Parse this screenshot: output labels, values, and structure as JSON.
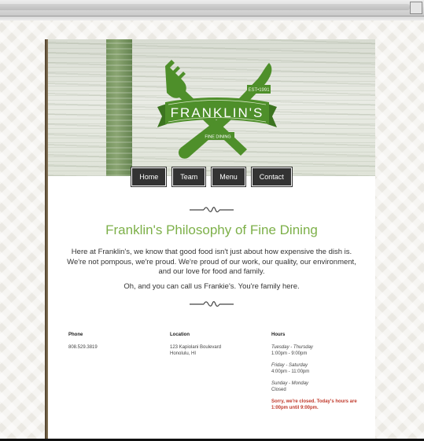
{
  "nav": {
    "items": [
      {
        "label": "Home"
      },
      {
        "label": "Team"
      },
      {
        "label": "Menu"
      },
      {
        "label": "Contact"
      }
    ]
  },
  "logo": {
    "name": "FRANKLIN'S",
    "est": "EST•1991",
    "tagline": "FINE DINING",
    "color": "#4e8f2a"
  },
  "main": {
    "title": "Franklin's Philosophy of Fine Dining",
    "intro": "Here at Franklin's, we know that good food isn't just about how expensive the dish is. We're not pompous, we're proud. We're proud of our work, our quality, our environment, and our love for food and family.",
    "intro2": "Oh, and you can call us Frankie's. You're family here."
  },
  "footer": {
    "phone": {
      "heading": "Phone",
      "value": "808.529.3819"
    },
    "location": {
      "heading": "Location",
      "line1": "123 Kapiolani Boulevard",
      "line2": "Honolulu, HI"
    },
    "hours": {
      "heading": "Hours",
      "blocks": [
        {
          "days": "Tuesday - Thursday",
          "time": "1:00pm - 9:00pm"
        },
        {
          "days": "Friday - Saturday",
          "time": "4:00pm - 11:00pm"
        },
        {
          "days": "Sunday - Monday",
          "time": "Closed"
        }
      ],
      "notice": "Sorry, we're closed. Today's hours are 1:00pm until 9:00pm."
    }
  },
  "colors": {
    "accent": "#7db049",
    "nav_bg": "#333333",
    "notice": "#c0392b"
  }
}
